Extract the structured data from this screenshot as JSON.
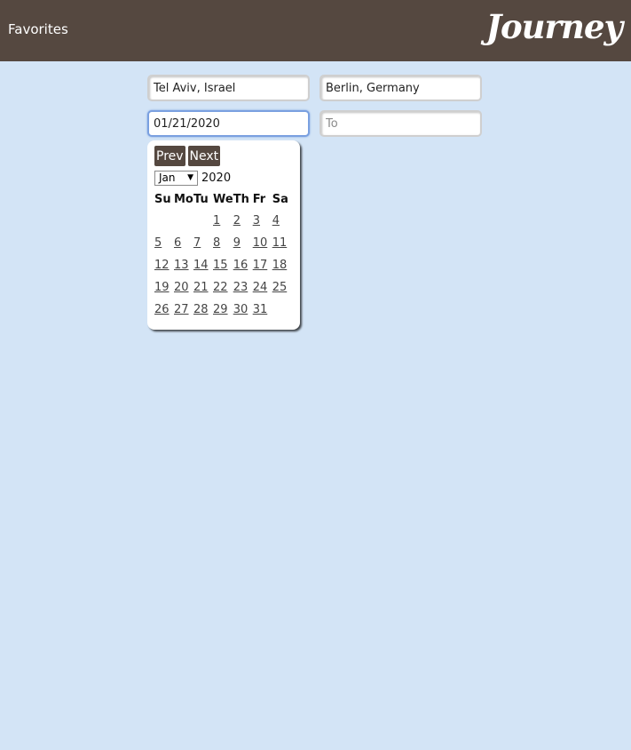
{
  "header": {
    "favorites_label": "Favorites",
    "logo_text": "Journey",
    "bar_color": "#554840"
  },
  "search": {
    "from_value": "Tel Aviv, Israel",
    "to_value": "Berlin, Germany",
    "start_date_value": "01/21/2020",
    "end_date_placeholder": "To"
  },
  "datepicker": {
    "prev_label": "Prev",
    "next_label": "Next",
    "month_selected": "Jan",
    "year": "2020",
    "weekdays": [
      "Su",
      "Mo",
      "Tu",
      "We",
      "Th",
      "Fr",
      "Sa"
    ],
    "weeks": [
      [
        "",
        "",
        "",
        "1",
        "2",
        "3",
        "4"
      ],
      [
        "5",
        "6",
        "7",
        "8",
        "9",
        "10",
        "11"
      ],
      [
        "12",
        "13",
        "14",
        "15",
        "16",
        "17",
        "18"
      ],
      [
        "19",
        "20",
        "21",
        "22",
        "23",
        "24",
        "25"
      ],
      [
        "26",
        "27",
        "28",
        "29",
        "30",
        "31",
        ""
      ]
    ]
  },
  "colors": {
    "page_background": "#d3e4f6",
    "button_background": "#554840"
  }
}
